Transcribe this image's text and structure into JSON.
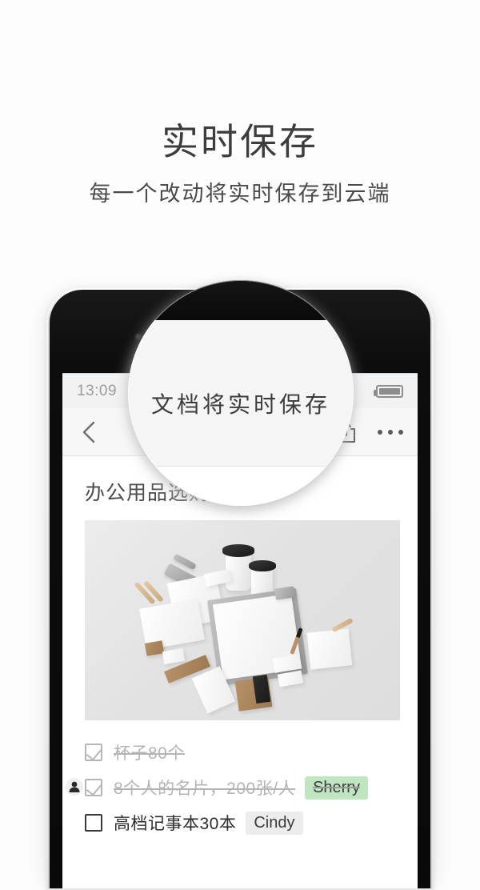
{
  "promo": {
    "title": "实时保存",
    "subtitle": "每一个改动将实时保存到云端"
  },
  "lens": {
    "label": "文档将实时保存"
  },
  "phone": {
    "statusbar": {
      "time": "13:09",
      "battery_icon": "battery-full-icon"
    },
    "navbar": {
      "back_icon": "chevron-left-icon",
      "share_icon": "share-upload-icon",
      "more_icon": "more-dots-icon"
    },
    "document": {
      "title": "办公用品选购",
      "photo_alt": "office-stationery-flatlay",
      "checklist": [
        {
          "checked": true,
          "text": "杯子80个",
          "tag": null,
          "tag_color": null,
          "avatar": false
        },
        {
          "checked": true,
          "text": "8个人的名片，200张/人",
          "tag": "Sherry",
          "tag_color": "#bfe6c0",
          "avatar": true
        },
        {
          "checked": false,
          "text": "高档记事本30本",
          "tag": "Cindy",
          "tag_color": "#ececec",
          "avatar": false
        }
      ]
    }
  }
}
